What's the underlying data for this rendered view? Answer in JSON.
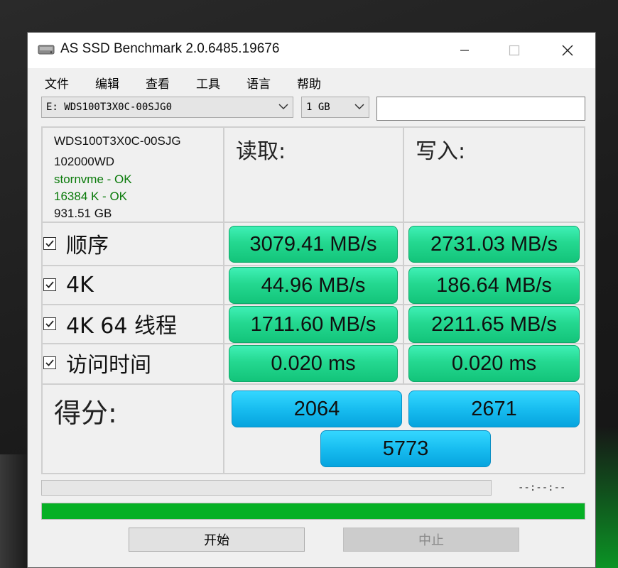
{
  "window": {
    "title": "AS SSD Benchmark 2.0.6485.19676",
    "controls": {
      "minimize": "–",
      "maximize": "□",
      "close": "✕"
    }
  },
  "menu": [
    "文件",
    "编辑",
    "查看",
    "工具",
    "语言",
    "帮助"
  ],
  "toolbar": {
    "drive_value": "E: WDS100T3X0C-00SJG0",
    "size_value": "1 GB",
    "extra_value": ""
  },
  "drive_info": {
    "model": "WDS100T3X0C-00SJG",
    "firmware": "102000WD",
    "driver": "stornvme - OK",
    "alignment": "16384 K - OK",
    "capacity": "931.51 GB"
  },
  "columns": {
    "read": "读取:",
    "write": "写入:"
  },
  "tests": [
    {
      "label": "顺序",
      "read": "3079.41 MB/s",
      "write": "2731.03 MB/s",
      "checked": true
    },
    {
      "label": "4K",
      "read": "44.96 MB/s",
      "write": "186.64 MB/s",
      "checked": true
    },
    {
      "label": "4K 64 线程",
      "read": "1711.60 MB/s",
      "write": "2211.65 MB/s",
      "checked": true
    },
    {
      "label": "访问时间",
      "read": "0.020 ms",
      "write": "0.020 ms",
      "checked": true
    }
  ],
  "score": {
    "label": "得分:",
    "read": "2064",
    "write": "2671",
    "total": "5773"
  },
  "status": {
    "elapsed": "--:--:--",
    "test_progress": 0,
    "overall_progress": 1.0
  },
  "buttons": {
    "start": "开始",
    "abort": "中止"
  },
  "colors": {
    "result_green": "#24d890",
    "score_blue": "#18bdf0",
    "progress_green": "#06b025"
  }
}
